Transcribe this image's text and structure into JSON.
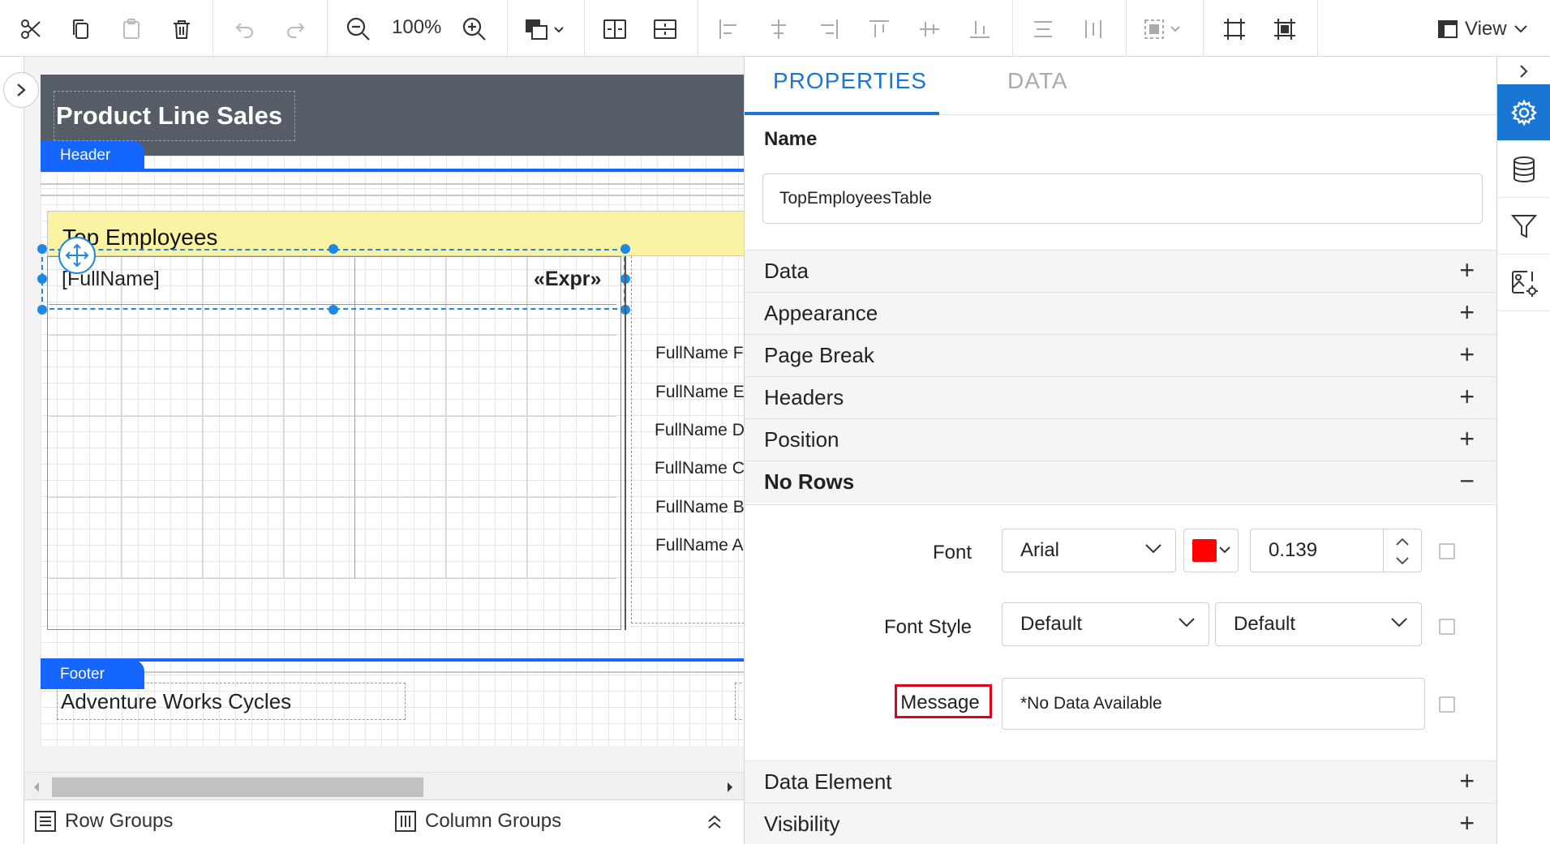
{
  "toolbar": {
    "zoom": "100%",
    "view_label": "View",
    "icons": [
      "cut-icon",
      "copy-icon",
      "paste-icon",
      "delete-icon",
      "undo-icon",
      "redo-icon",
      "zoom-out-icon",
      "zoom-in-icon",
      "layer-order-icon",
      "insert-row-icon",
      "insert-column-icon",
      "align-left-icon",
      "align-center-icon",
      "align-right-icon",
      "align-top-icon",
      "align-middle-icon",
      "align-bottom-icon",
      "distribute-horizontal-icon",
      "distribute-vertical-icon",
      "select-group-icon",
      "size-to-grid-icon",
      "fit-to-page-icon",
      "view-icon"
    ]
  },
  "designer": {
    "report_title": "Product Line Sales",
    "header_tag": "Header",
    "footer_tag": "Footer",
    "table_title": "Top Employees",
    "cell_fullname": "[FullName]",
    "cell_expr": "«Expr»",
    "chart_labels": [
      "FullName F",
      "FullName E",
      "FullName D",
      "FullName C",
      "FullName B",
      "FullName A"
    ],
    "footer_text": "Adventure Works Cycles"
  },
  "bottom_bar": {
    "row_groups": "Row Groups",
    "column_groups": "Column Groups"
  },
  "properties": {
    "tabs": [
      "PROPERTIES",
      "DATA"
    ],
    "name_label": "Name",
    "name_value": "TopEmployeesTable",
    "sections": {
      "data": "Data",
      "appearance": "Appearance",
      "page_break": "Page Break",
      "headers": "Headers",
      "position": "Position",
      "no_rows": "No Rows",
      "data_element": "Data Element",
      "visibility": "Visibility"
    },
    "no_rows": {
      "font_label": "Font",
      "font_family": "Arial",
      "font_color": "#ff0000",
      "font_size": "0.139",
      "font_style_label": "Font Style",
      "font_style": "Default",
      "font_weight": "Default",
      "message_label": "Message",
      "message_value": "*No Data Available"
    }
  },
  "colors": {
    "accent": "#1976d2",
    "band_blue": "#1565ff",
    "title_bar": "#575d66",
    "table_header_yellow": "#faf3a3",
    "highlight_red": "#e0001b"
  }
}
